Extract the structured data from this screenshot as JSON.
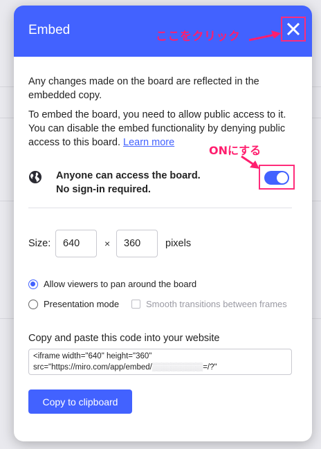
{
  "modal": {
    "title": "Embed",
    "annotation_click": "ここをクリック",
    "annotation_on": "ONにする",
    "intro": "Any changes made on the board are reflected in the embedded copy.",
    "public_access_text": "To embed the board, you need to allow public access to it. You can disable the embed functionality by denying public access to this board.",
    "learn_more": "Learn more",
    "access_line1": "Anyone can access the board.",
    "access_line2": "No sign-in required.",
    "access_toggle_on": true,
    "size_label": "Size:",
    "width_value": "640",
    "height_value": "360",
    "times_symbol": "×",
    "pixels_label": "pixels",
    "radio_pan": "Allow viewers to pan around the board",
    "radio_presentation": "Presentation mode",
    "smooth_transitions": "Smooth transitions between frames",
    "copy_label": "Copy and paste this code into your website",
    "code_line1": "<iframe width=\"640\" height=\"360\"",
    "code_line2_prefix": "src=\"https://miro.com/app/embed/",
    "code_line2_suffix": "=/?\"",
    "copy_button": "Copy to clipboard"
  },
  "colors": {
    "accent": "#4262ff",
    "annotation": "#ff1e6e"
  },
  "icons": {
    "close": "close-icon",
    "globe": "globe-icon"
  }
}
